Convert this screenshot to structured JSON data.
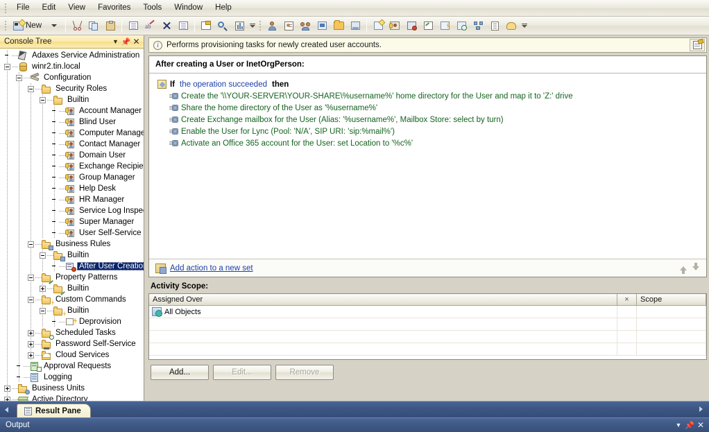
{
  "window": {
    "menu": [
      "File",
      "Edit",
      "View",
      "Favorites",
      "Tools",
      "Window",
      "Help"
    ],
    "toolbar": {
      "new_label": "New",
      "icons": [
        "new-icon",
        "dropdown-arrow-icon",
        "cut-icon",
        "copy-icon",
        "paste-icon",
        "properties-icon",
        "rename-icon",
        "delete-icon",
        "export-list-icon",
        "help-icon",
        "find-icon",
        "report-icon",
        "user-icon",
        "contact-icon",
        "group-icon",
        "computer-icon",
        "ou-icon",
        "container-icon",
        "new-object-icon",
        "security-role-icon",
        "business-rule-icon",
        "property-pattern-icon",
        "custom-command-icon",
        "scheduled-task-icon",
        "business-unit-icon",
        "report-doc-icon",
        "cloud-services-icon"
      ]
    }
  },
  "console_tree": {
    "caption": "Console Tree",
    "caption_buttons": [
      "chevron-down-icon",
      "pin-icon",
      "close-icon"
    ],
    "nodes": [
      {
        "label": "Adaxes Service Administration",
        "level": 0,
        "expander": "none",
        "icon": "adaxes-icon",
        "selected": false
      },
      {
        "label": "winr2.tin.local",
        "level": 0,
        "expander": "minus",
        "icon": "server-icon",
        "selected": false
      },
      {
        "label": "Configuration",
        "level": 1,
        "expander": "minus",
        "icon": "configuration-icon",
        "selected": false
      },
      {
        "label": "Security Roles",
        "level": 2,
        "expander": "minus",
        "icon": "security-roles-folder-icon",
        "selected": false
      },
      {
        "label": "Builtin",
        "level": 3,
        "expander": "minus",
        "icon": "security-roles-folder-icon",
        "selected": false
      },
      {
        "label": "Account Manager",
        "level": 4,
        "expander": "none",
        "icon": "security-role-icon",
        "selected": false
      },
      {
        "label": "Blind User",
        "level": 4,
        "expander": "none",
        "icon": "security-role-icon",
        "selected": false
      },
      {
        "label": "Computer Manager",
        "level": 4,
        "expander": "none",
        "icon": "security-role-icon",
        "selected": false
      },
      {
        "label": "Contact Manager",
        "level": 4,
        "expander": "none",
        "icon": "security-role-icon",
        "selected": false
      },
      {
        "label": "Domain User",
        "level": 4,
        "expander": "none",
        "icon": "security-role-icon",
        "selected": false
      },
      {
        "label": "Exchange Recipient Administrator",
        "level": 4,
        "expander": "none",
        "icon": "security-role-icon",
        "selected": false
      },
      {
        "label": "Group Manager",
        "level": 4,
        "expander": "none",
        "icon": "security-role-icon",
        "selected": false
      },
      {
        "label": "Help Desk",
        "level": 4,
        "expander": "none",
        "icon": "security-role-icon",
        "selected": false
      },
      {
        "label": "HR Manager",
        "level": 4,
        "expander": "none",
        "icon": "security-role-icon",
        "selected": false
      },
      {
        "label": "Service Log Inspector",
        "level": 4,
        "expander": "none",
        "icon": "security-role-icon",
        "selected": false
      },
      {
        "label": "Super Manager",
        "level": 4,
        "expander": "none",
        "icon": "security-role-icon",
        "selected": false
      },
      {
        "label": "User Self-Service",
        "level": 4,
        "expander": "none",
        "icon": "security-role-icon",
        "selected": false
      },
      {
        "label": "Business Rules",
        "level": 2,
        "expander": "minus",
        "icon": "business-rules-folder-icon",
        "selected": false
      },
      {
        "label": "Builtin",
        "level": 3,
        "expander": "minus",
        "icon": "business-rules-folder-icon",
        "selected": false
      },
      {
        "label": "After User Creation",
        "level": 4,
        "expander": "none",
        "icon": "business-rule-icon",
        "selected": true
      },
      {
        "label": "Property Patterns",
        "level": 2,
        "expander": "minus",
        "icon": "property-patterns-folder-icon",
        "selected": false
      },
      {
        "label": "Builtin",
        "level": 3,
        "expander": "plus",
        "icon": "property-patterns-folder-icon",
        "selected": false
      },
      {
        "label": "Custom Commands",
        "level": 2,
        "expander": "minus",
        "icon": "custom-commands-folder-icon",
        "selected": false
      },
      {
        "label": "Builtin",
        "level": 3,
        "expander": "minus",
        "icon": "custom-commands-folder-icon",
        "selected": false
      },
      {
        "label": "Deprovision",
        "level": 4,
        "expander": "none",
        "icon": "custom-command-icon",
        "selected": false
      },
      {
        "label": "Scheduled Tasks",
        "level": 2,
        "expander": "plus",
        "icon": "scheduled-tasks-folder-icon",
        "selected": false
      },
      {
        "label": "Password Self-Service",
        "level": 2,
        "expander": "plus",
        "icon": "password-self-service-folder-icon",
        "selected": false
      },
      {
        "label": "Cloud Services",
        "level": 2,
        "expander": "plus",
        "icon": "cloud-services-folder-icon",
        "selected": false
      },
      {
        "label": "Approval Requests",
        "level": 1,
        "expander": "none",
        "icon": "approval-requests-icon",
        "selected": false
      },
      {
        "label": "Logging",
        "level": 1,
        "expander": "none",
        "icon": "logging-icon",
        "selected": false
      },
      {
        "label": "Business Units",
        "level": 0,
        "expander": "plus",
        "icon": "business-units-icon",
        "selected": false
      },
      {
        "label": "Active Directory",
        "level": 0,
        "expander": "plus",
        "icon": "active-directory-icon",
        "selected": false
      }
    ]
  },
  "result_pane": {
    "info_bar": {
      "text": "Performs provisioning tasks for newly created user accounts.",
      "icon": "info-icon",
      "action_icon": "edit-description-icon"
    },
    "rule": {
      "title": "After creating a User or InetOrgPerson:",
      "condition": {
        "if_label": "If",
        "expression": "the operation succeeded",
        "then_label": "then",
        "icon": "condition-icon"
      },
      "actions": [
        "Create the '\\\\YOUR-SERVER\\YOUR-SHARE\\%username%' home directory for the User and map it to 'Z:' drive",
        "Share the home directory of the User as '%username%'",
        "Create Exchange mailbox for the User (Alias: '%username%', Mailbox Store: select by turn)",
        "Enable the User for Lync (Pool: 'N/A', SIP URI: 'sip:%mail%')",
        "Activate an Office 365 account for the User: set Location to '%c%'"
      ],
      "footer": {
        "add_action_link": "Add action to a new set",
        "link_icon": "add-action-set-icon",
        "move_up_icon": "move-up-arrow-icon",
        "move_down_icon": "move-down-arrow-icon"
      }
    },
    "activity_scope": {
      "label": "Activity Scope:",
      "columns": [
        "Assigned Over",
        "×",
        "Scope"
      ],
      "rows": [
        {
          "assigned_over": "All Objects",
          "exclude": "",
          "scope": "",
          "icon": "all-objects-icon"
        }
      ],
      "empty_row_count": 3,
      "buttons": [
        {
          "label": "Add...",
          "disabled": false
        },
        {
          "label": "Edit...",
          "disabled": true
        },
        {
          "label": "Remove",
          "disabled": true
        }
      ]
    }
  },
  "bottom_tabs": {
    "scroll_left_icon": "scroll-left-icon",
    "scroll_right_icon": "scroll-right-icon",
    "tabs": [
      {
        "label": "Result Pane",
        "icon": "result-pane-icon",
        "active": true
      }
    ]
  },
  "output_panel": {
    "title": "Output",
    "buttons": [
      "chevron-down-icon",
      "pin-icon",
      "close-icon"
    ]
  },
  "colors": {
    "accent_blue": "#1b3fa8",
    "action_green": "#14631f",
    "selection_blue": "#0a246a",
    "caption_gold": "#f8dd88",
    "chrome_tan": "#d6d2c6",
    "tabstrip_blue": "#3c5582"
  }
}
